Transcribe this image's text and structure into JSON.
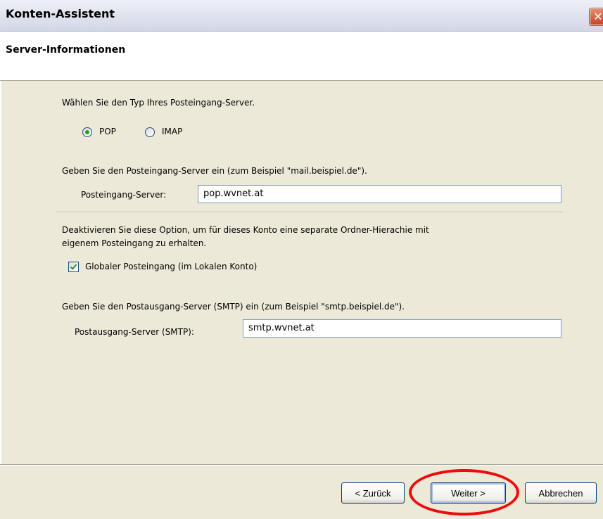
{
  "window": {
    "title": "Konten-Assistent",
    "close_icon": "close-icon"
  },
  "header": {
    "page_title": "Server-Informationen"
  },
  "incoming_type": {
    "prompt": "Wählen Sie den Typ Ihres Posteingang-Server.",
    "options": [
      {
        "label": "POP",
        "selected": true
      },
      {
        "label": "IMAP",
        "selected": false
      }
    ]
  },
  "incoming_server": {
    "prompt": "Geben Sie den Posteingang-Server ein (zum Beispiel \"mail.beispiel.de\").",
    "label": "Posteingang-Server:",
    "value": "pop.wvnet.at"
  },
  "global_inbox": {
    "description_line1": "Deaktivieren Sie diese Option, um für dieses Konto eine separate Ordner-Hierachie mit",
    "description_line2": "eigenem Posteingang zu erhalten.",
    "label": "Globaler Posteingang (im Lokalen Konto)",
    "checked": true
  },
  "outgoing_server": {
    "prompt": "Geben Sie den Postausgang-Server (SMTP) ein (zum Beispiel \"smtp.beispiel.de\").",
    "label": "Postausgang-Server (SMTP):",
    "value": "smtp.wvnet.at"
  },
  "buttons": {
    "back": "< Zurück",
    "next": "Weiter >",
    "cancel": "Abbrechen"
  },
  "colors": {
    "dialog_bg": "#ece9d8",
    "highlight_ring": "#ee0b0b",
    "check_green": "#21a121"
  }
}
